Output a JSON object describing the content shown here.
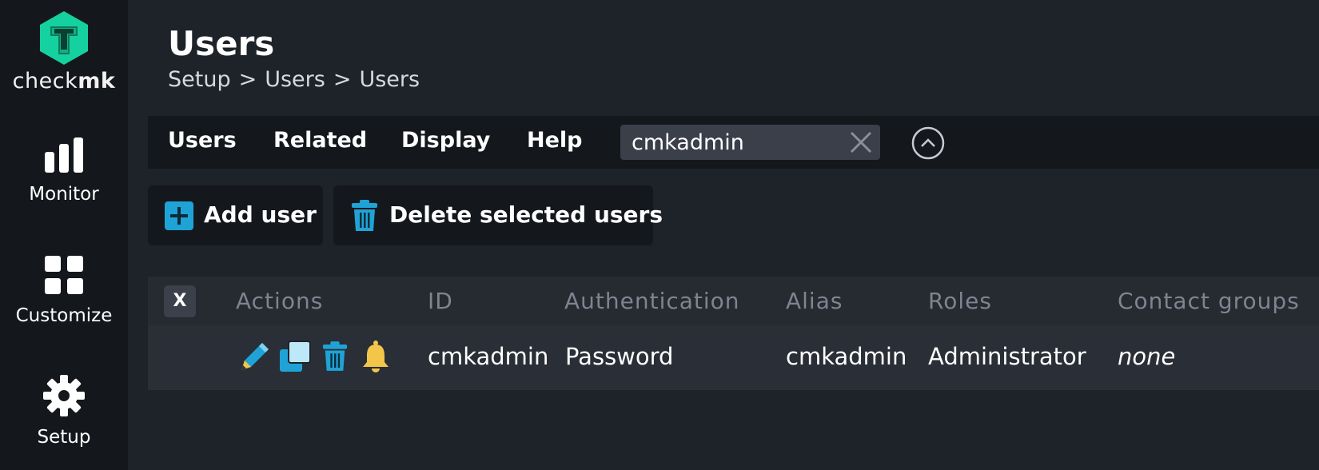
{
  "sidebar": {
    "logo": {
      "text_light": "check",
      "text_bold": "mk"
    },
    "items": [
      {
        "label": "Monitor",
        "icon": "bar-chart-icon"
      },
      {
        "label": "Customize",
        "icon": "grid-icon"
      },
      {
        "label": "Setup",
        "icon": "gear-icon"
      }
    ]
  },
  "header": {
    "title": "Users",
    "breadcrumb": [
      "Setup",
      "Users",
      "Users"
    ],
    "breadcrumb_separator": ">"
  },
  "menubar": {
    "items": [
      "Users",
      "Related",
      "Display",
      "Help"
    ],
    "search": {
      "value": "cmkadmin",
      "placeholder": ""
    }
  },
  "actions": {
    "add_user": "Add user",
    "delete_selected": "Delete selected users"
  },
  "table": {
    "select_all_label": "X",
    "headers": [
      "Actions",
      "ID",
      "Authentication",
      "Alias",
      "Roles",
      "Contact groups"
    ],
    "rows": [
      {
        "action_icons": [
          "edit-pencil-icon",
          "clone-icon",
          "delete-trash-icon",
          "notification-bell-icon"
        ],
        "id": "cmkadmin",
        "authentication": "Password",
        "alias": "cmkadmin",
        "roles": "Administrator",
        "contact_groups": "none"
      }
    ]
  },
  "colors": {
    "background": "#1e2229",
    "sidebar": "#14181d",
    "brand_green": "#15d1a0",
    "icon_blue": "#1fa3d6",
    "bell_yellow": "#f3c64a",
    "header_text": "#7e8590"
  }
}
